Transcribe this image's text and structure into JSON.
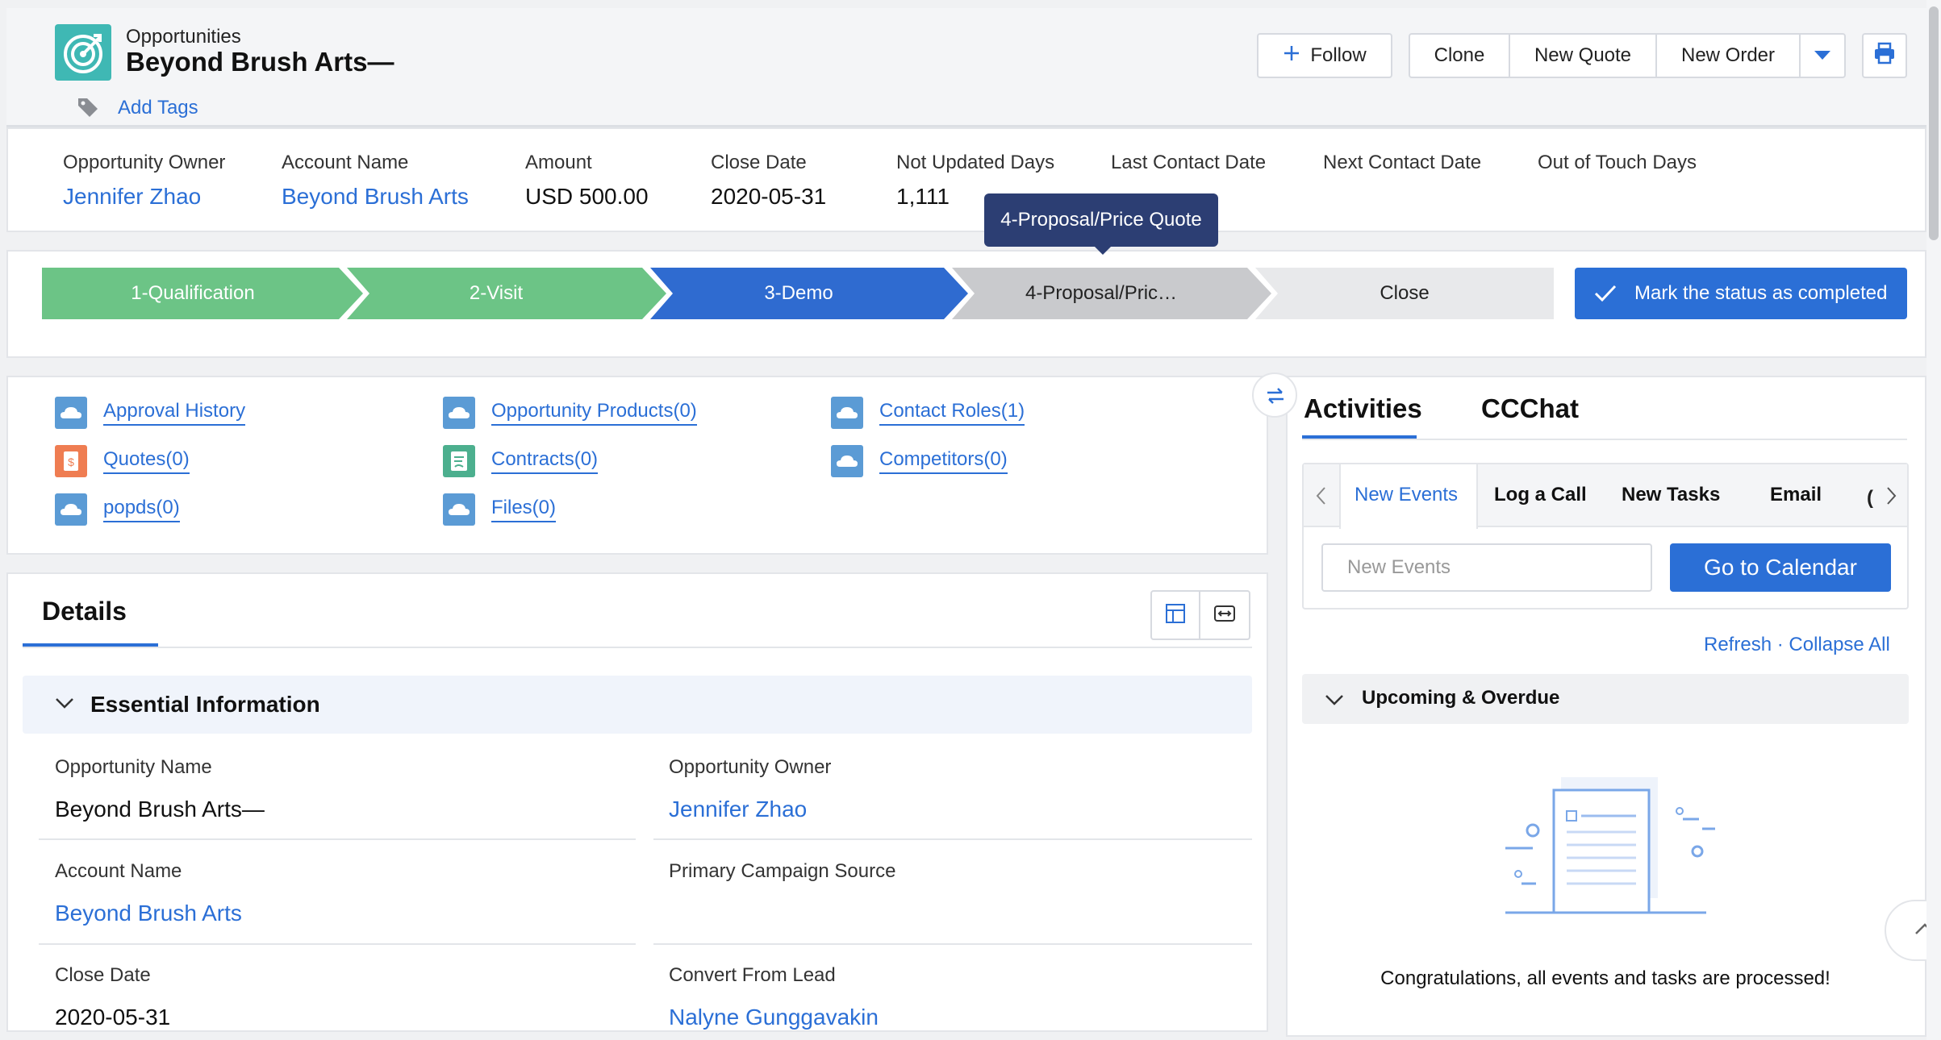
{
  "header": {
    "breadcrumb": "Opportunities",
    "title": "Beyond Brush Arts—",
    "add_tags": "Add Tags",
    "follow": "Follow",
    "clone": "Clone",
    "new_quote": "New Quote",
    "new_order": "New Order"
  },
  "summary": [
    {
      "label": "Opportunity Owner",
      "value": "Jennifer Zhao"
    },
    {
      "label": "Account Name",
      "value": "Beyond Brush Arts"
    },
    {
      "label": "Amount",
      "value": "USD 500.00"
    },
    {
      "label": "Close Date",
      "value": "2020-05-31"
    },
    {
      "label": "Not Updated Days",
      "value": "1,111"
    },
    {
      "label": "Last Contact Date",
      "value": ""
    },
    {
      "label": "Next Contact Date",
      "value": ""
    },
    {
      "label": "Out of Touch Days",
      "value": ""
    }
  ],
  "tooltip": "4-Proposal/Price Quote",
  "stages": [
    {
      "label": "1-Qualification",
      "status": "completed"
    },
    {
      "label": "2-Visit",
      "status": "completed"
    },
    {
      "label": "3-Demo",
      "status": "current"
    },
    {
      "label": "4-Proposal/Pric…",
      "status": "hovered"
    },
    {
      "label": "Close",
      "status": "pending"
    }
  ],
  "mark_status": "Mark the status as completed",
  "related": [
    {
      "label": "Approval History",
      "icon": "cloud-icon"
    },
    {
      "label": "Opportunity Products(0)",
      "icon": "cloud-icon"
    },
    {
      "label": "Contact Roles(1)",
      "icon": "cloud-icon"
    },
    {
      "label": "Quotes(0)",
      "icon": "quote-icon"
    },
    {
      "label": "Contracts(0)",
      "icon": "contract-icon"
    },
    {
      "label": "Competitors(0)",
      "icon": "cloud-icon"
    },
    {
      "label": "popds(0)",
      "icon": "cloud-icon"
    },
    {
      "label": "Files(0)",
      "icon": "cloud-icon"
    }
  ],
  "details": {
    "tab": "Details",
    "section": "Essential Information",
    "fields": [
      {
        "label": "Opportunity Name",
        "value": "Beyond Brush Arts—",
        "link": false
      },
      {
        "label": "Opportunity Owner",
        "value": "Jennifer Zhao",
        "link": true
      },
      {
        "label": "Account Name",
        "value": "Beyond Brush Arts",
        "link": true
      },
      {
        "label": "Primary Campaign Source",
        "value": "",
        "link": false
      },
      {
        "label": "Close Date",
        "value": "2020-05-31",
        "link": false
      },
      {
        "label": "Convert From Lead",
        "value": "Nalyne Gunggavakin",
        "link": true
      }
    ]
  },
  "activities": {
    "tab_activities": "Activities",
    "tab_ccchat": "CCChat",
    "tabs": [
      "New Events",
      "Log a Call",
      "New Tasks",
      "Email"
    ],
    "input_placeholder": "New Events",
    "go_calendar": "Go to Calendar",
    "refresh": "Refresh",
    "collapse_all": "Collapse All",
    "upcoming": "Upcoming & Overdue",
    "empty_message": "Congratulations, all events and tasks are processed!"
  },
  "colors": {
    "accent": "#2b6fd6",
    "completed_stage": "#6cc486",
    "current_stage": "#2f6bd0",
    "hover_stage": "#c9cacd",
    "pending_stage": "#e8e9eb",
    "tooltip": "#2c3e73"
  }
}
